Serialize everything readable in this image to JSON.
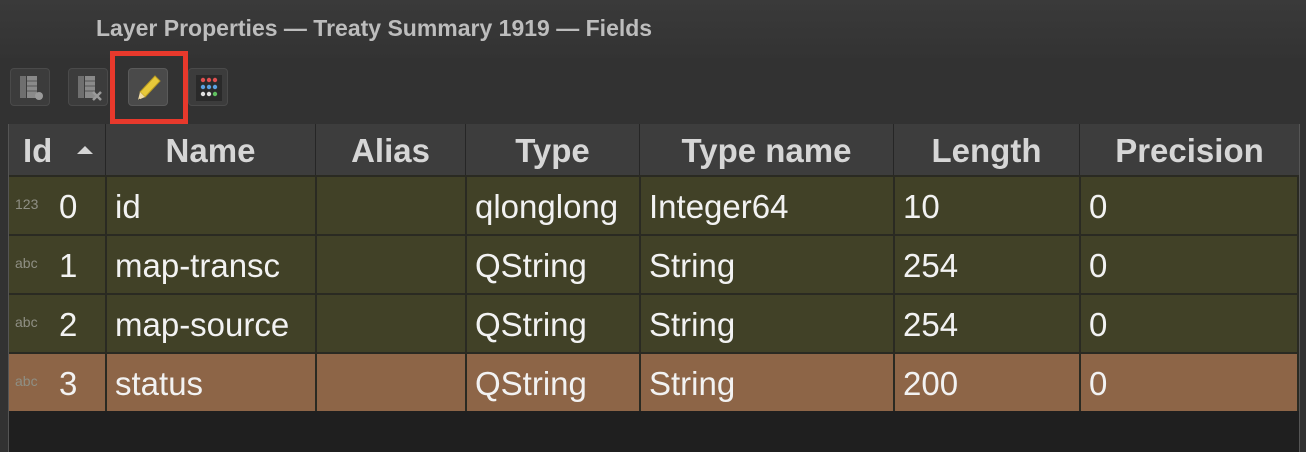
{
  "window": {
    "title": "Layer Properties — Treaty Summary 1919 — Fields"
  },
  "toolbar": {
    "buttons": [
      {
        "name": "new-field-icon"
      },
      {
        "name": "delete-field-icon"
      },
      {
        "name": "toggle-editing-pencil-icon"
      },
      {
        "name": "field-calculator-icon"
      }
    ]
  },
  "colors": {
    "row_default": "#414127",
    "row_selected": "#8d6547",
    "highlight": "#e8392c"
  },
  "table": {
    "columns": [
      "Id",
      "Name",
      "Alias",
      "Type",
      "Type name",
      "Length",
      "Precision"
    ],
    "rows": [
      {
        "type_icon": "123",
        "id": "0",
        "name": "id",
        "alias": "",
        "type": "qlonglong",
        "type_name": "Integer64",
        "length": "10",
        "precision": "0"
      },
      {
        "type_icon": "abc",
        "id": "1",
        "name": "map-transc",
        "alias": "",
        "type": "QString",
        "type_name": "String",
        "length": "254",
        "precision": "0"
      },
      {
        "type_icon": "abc",
        "id": "2",
        "name": "map-source",
        "alias": "",
        "type": "QString",
        "type_name": "String",
        "length": "254",
        "precision": "0"
      },
      {
        "type_icon": "abc",
        "id": "3",
        "name": "status",
        "alias": "",
        "type": "QString",
        "type_name": "String",
        "length": "200",
        "precision": "0"
      }
    ]
  }
}
